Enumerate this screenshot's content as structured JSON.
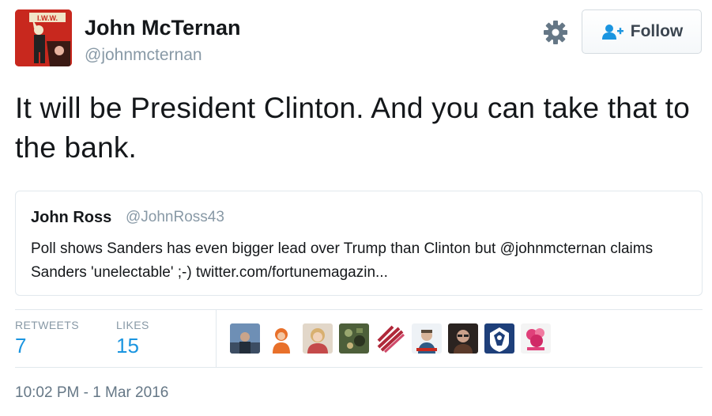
{
  "author": {
    "name": "John McTernan",
    "handle": "@johnmcternan",
    "avatar_icon": "iww-poster-avatar",
    "avatar_text": "I.W.W."
  },
  "actions": {
    "settings_icon": "gear-icon",
    "follow_label": "Follow",
    "follow_icon": "add-user-icon"
  },
  "tweet": {
    "text": "It will be President Clinton. And you can take that to the bank."
  },
  "quoted_tweet": {
    "name": "John Ross",
    "handle": "@JohnRoss43",
    "text": "Poll shows Sanders has even bigger lead over Trump than Clinton but @johnmcternan claims Sanders 'unelectable' ;-) twitter.com/fortunemagazin..."
  },
  "stats": {
    "retweets_label": "RETWEETS",
    "retweets_value": "7",
    "likes_label": "LIKES",
    "likes_value": "15"
  },
  "likers": [
    {
      "icon": "liker-avatar-1"
    },
    {
      "icon": "liker-avatar-2"
    },
    {
      "icon": "liker-avatar-3"
    },
    {
      "icon": "liker-avatar-4"
    },
    {
      "icon": "liker-avatar-5"
    },
    {
      "icon": "liker-avatar-6"
    },
    {
      "icon": "liker-avatar-7"
    },
    {
      "icon": "liker-avatar-8"
    },
    {
      "icon": "liker-avatar-9"
    }
  ],
  "timestamp": "10:02 PM - 1 Mar 2016",
  "colors": {
    "link_blue": "#1b95e0",
    "muted_gray": "#8899a6",
    "avatar_red": "#c8281e"
  }
}
